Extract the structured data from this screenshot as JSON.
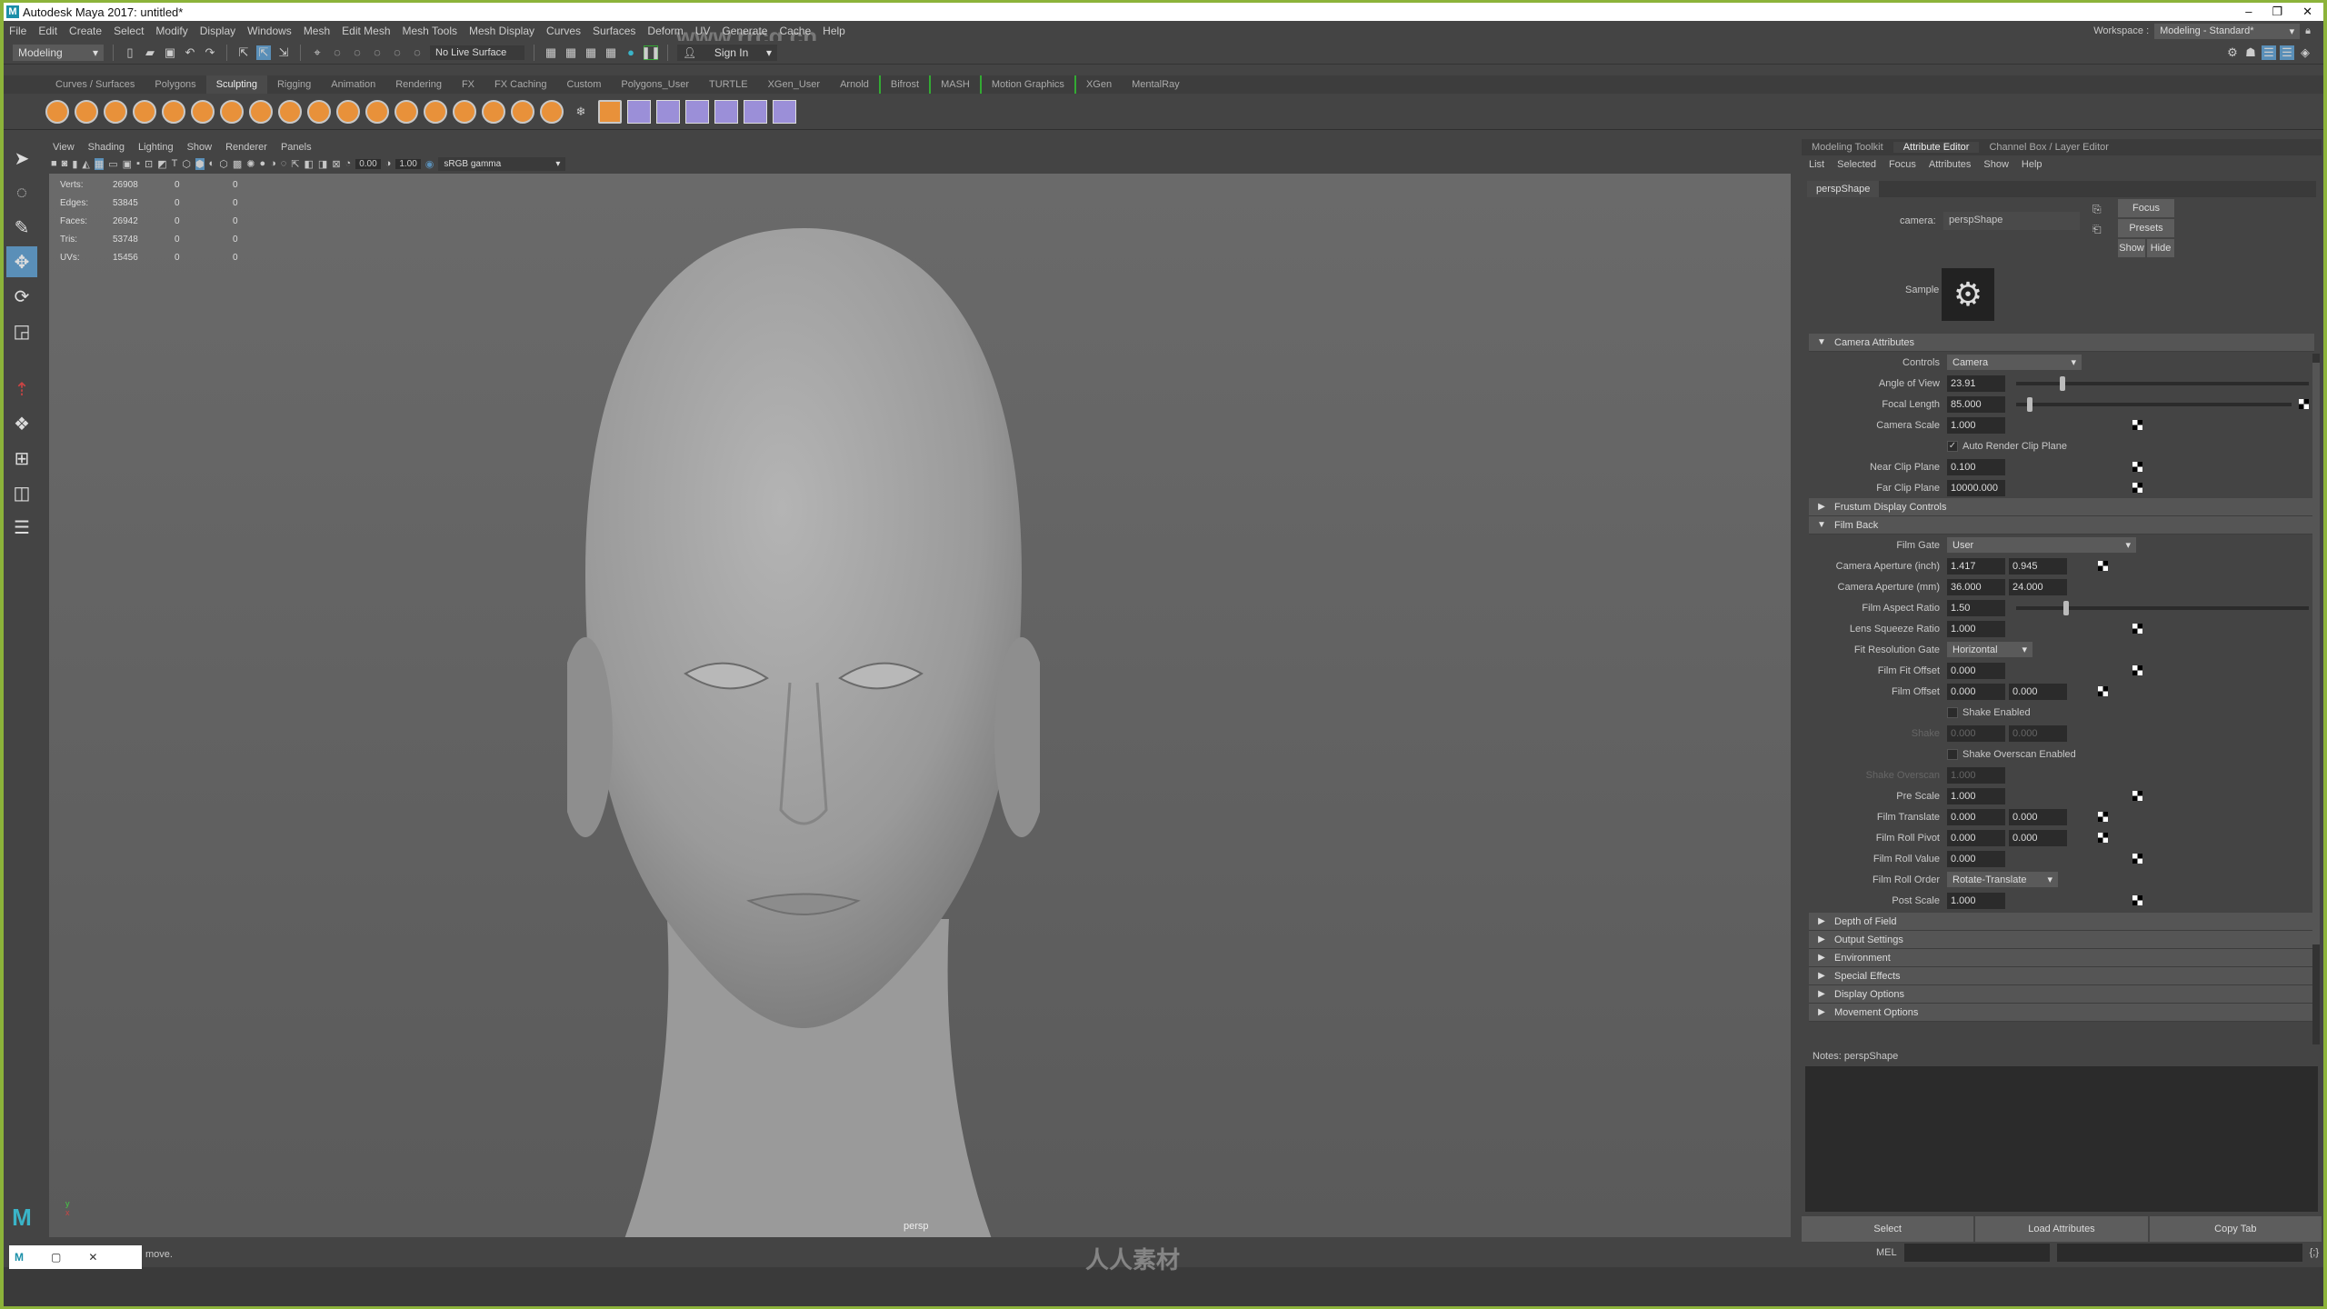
{
  "titlebar": {
    "title": "Autodesk Maya 2017: untitled*",
    "watermark": "www.rrcg.cn"
  },
  "menubar": {
    "items": [
      "File",
      "Edit",
      "Create",
      "Select",
      "Modify",
      "Display",
      "Windows",
      "Mesh",
      "Edit Mesh",
      "Mesh Tools",
      "Mesh Display",
      "Curves",
      "Surfaces",
      "Deform",
      "UV",
      "Generate",
      "Cache",
      "Help"
    ],
    "workspace_label": "Workspace :",
    "workspace_value": "Modeling - Standard*"
  },
  "statusline": {
    "mode": "Modeling",
    "live_surface": "No Live Surface",
    "sign_in": "Sign In"
  },
  "shelf": {
    "tabs": [
      "Curves / Surfaces",
      "Polygons",
      "Sculpting",
      "Rigging",
      "Animation",
      "Rendering",
      "FX",
      "FX Caching",
      "Custom",
      "Polygons_User",
      "TURTLE",
      "XGen_User",
      "Arnold",
      "Bifrost",
      "MASH",
      "Motion Graphics",
      "XGen",
      "MentalRay"
    ],
    "active_tab": "Sculpting"
  },
  "viewport": {
    "menu": [
      "View",
      "Shading",
      "Lighting",
      "Show",
      "Renderer",
      "Panels"
    ],
    "exposure": "0.00",
    "gamma": "1.00",
    "color_space": "sRGB gamma",
    "camera_label": "persp",
    "hud": [
      {
        "label": "Verts:",
        "v1": "26908",
        "v2": "0",
        "v3": "0"
      },
      {
        "label": "Edges:",
        "v1": "53845",
        "v2": "0",
        "v3": "0"
      },
      {
        "label": "Faces:",
        "v1": "26942",
        "v2": "0",
        "v3": "0"
      },
      {
        "label": "Tris:",
        "v1": "53748",
        "v2": "0",
        "v3": "0"
      },
      {
        "label": "UVs:",
        "v1": "15456",
        "v2": "0",
        "v3": "0"
      }
    ]
  },
  "attribute_editor": {
    "tabs": [
      "Modeling Toolkit",
      "Attribute Editor",
      "Channel Box / Layer Editor"
    ],
    "active_tab": "Attribute Editor",
    "menu": [
      "List",
      "Selected",
      "Focus",
      "Attributes",
      "Show",
      "Help"
    ],
    "node_tab": "perspShape",
    "camera_label": "camera:",
    "camera_value": "perspShape",
    "focus_btn": "Focus",
    "presets_btn": "Presets",
    "show_btn": "Show",
    "hide_btn": "Hide",
    "sample_label": "Sample",
    "camera_attributes": {
      "title": "Camera Attributes",
      "controls_label": "Controls",
      "controls_value": "Camera",
      "angle_of_view_label": "Angle of View",
      "angle_of_view": "23.91",
      "angle_of_view_slider": 0.15,
      "focal_length_label": "Focal Length",
      "focal_length": "85.000",
      "focal_length_slider": 0.04,
      "camera_scale_label": "Camera Scale",
      "camera_scale": "1.000",
      "auto_clip_label": "Auto Render Clip Plane",
      "auto_clip_checked": true,
      "near_clip_label": "Near Clip Plane",
      "near_clip": "0.100",
      "far_clip_label": "Far Clip Plane",
      "far_clip": "10000.000"
    },
    "frustum_title": "Frustum Display Controls",
    "film_back": {
      "title": "Film Back",
      "film_gate_label": "Film Gate",
      "film_gate": "User",
      "aperture_inch_label": "Camera Aperture (inch)",
      "aperture_inch_x": "1.417",
      "aperture_inch_y": "0.945",
      "aperture_mm_label": "Camera Aperture (mm)",
      "aperture_mm_x": "36.000",
      "aperture_mm_y": "24.000",
      "aspect_label": "Film Aspect Ratio",
      "aspect": "1.50",
      "aspect_slider": 0.16,
      "lens_squeeze_label": "Lens Squeeze Ratio",
      "lens_squeeze": "1.000",
      "fit_gate_label": "Fit Resolution Gate",
      "fit_gate": "Horizontal",
      "fit_offset_label": "Film Fit Offset",
      "fit_offset": "0.000",
      "film_offset_label": "Film Offset",
      "film_offset_x": "0.000",
      "film_offset_y": "0.000",
      "shake_enabled_label": "Shake Enabled",
      "shake_label": "Shake",
      "shake_x": "0.000",
      "shake_y": "0.000",
      "shake_overscan_enabled_label": "Shake Overscan Enabled",
      "shake_overscan_label": "Shake Overscan",
      "shake_overscan": "1.000",
      "pre_scale_label": "Pre Scale",
      "pre_scale": "1.000",
      "film_translate_label": "Film Translate",
      "film_translate_x": "0.000",
      "film_translate_y": "0.000",
      "roll_pivot_label": "Film Roll Pivot",
      "roll_pivot_x": "0.000",
      "roll_pivot_y": "0.000",
      "roll_value_label": "Film Roll Value",
      "roll_value": "0.000",
      "roll_order_label": "Film Roll Order",
      "roll_order": "Rotate-Translate",
      "post_scale_label": "Post Scale",
      "post_scale": "1.000"
    },
    "collapsed_sections": [
      "Depth of Field",
      "Output Settings",
      "Environment",
      "Special Effects",
      "Display Options",
      "Movement Options"
    ],
    "notes_label": "Notes:",
    "notes_node": "perspShape",
    "buttons": {
      "select": "Select",
      "load": "Load Attributes",
      "copy": "Copy Tab"
    }
  },
  "bottom": {
    "help_text": "move.",
    "mel_label": "MEL",
    "watermark": "人人素材"
  }
}
